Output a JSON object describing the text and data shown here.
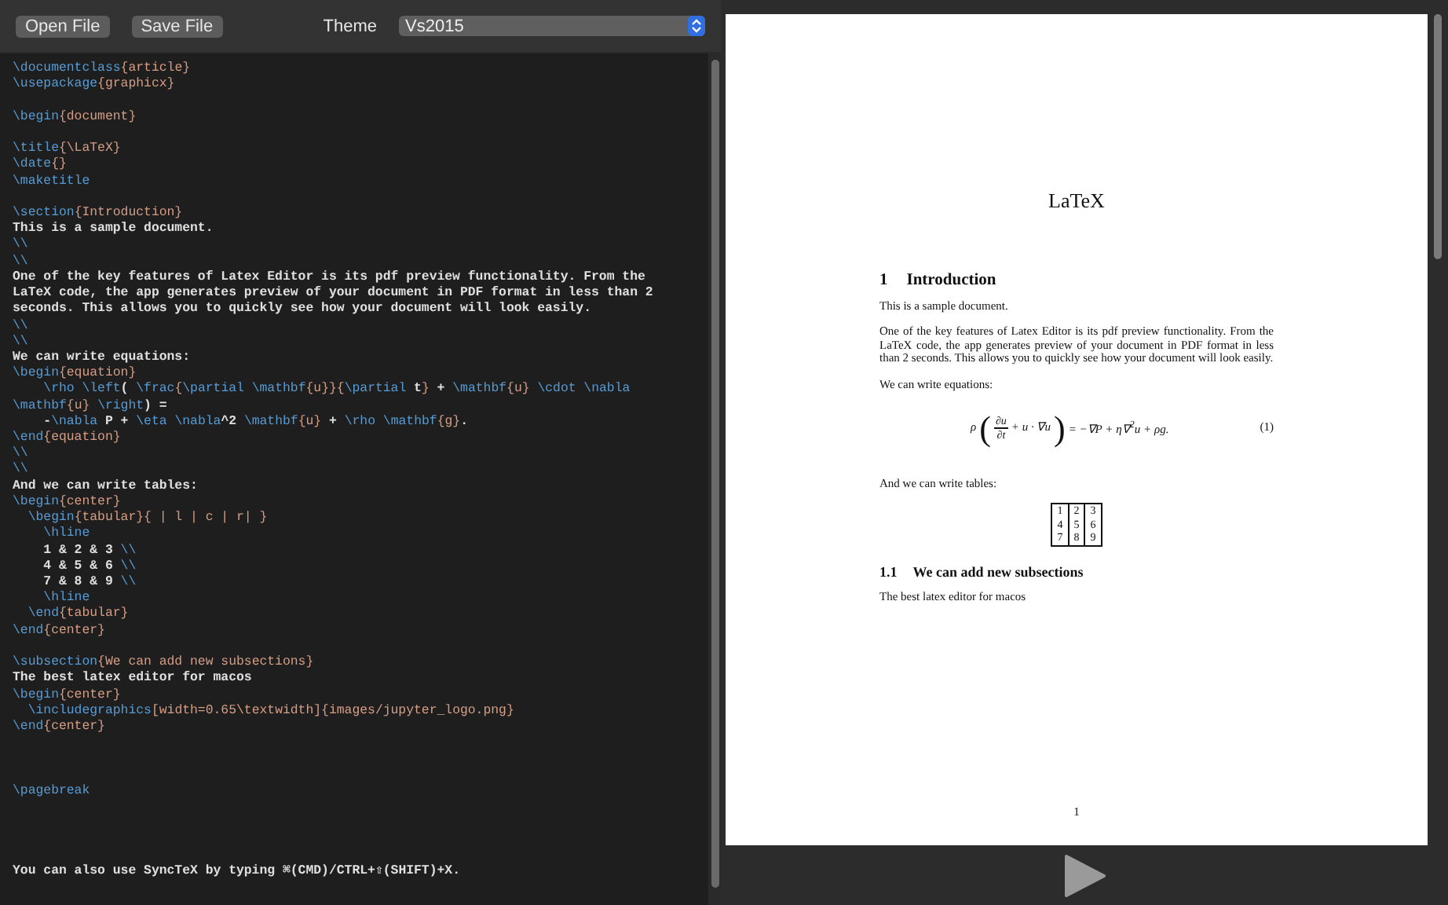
{
  "toolbar": {
    "buttons": [
      {
        "label": "Open File"
      },
      {
        "label": "Save File"
      }
    ],
    "theme_label": "Theme",
    "theme_value": "Vs2015"
  },
  "editor": {
    "lines": [
      {
        "kind": "code",
        "tokens": [
          {
            "kind": "cmd",
            "text": "\\documentclass"
          },
          {
            "kind": "arg",
            "text": "{article}"
          }
        ]
      },
      {
        "kind": "code",
        "tokens": [
          {
            "kind": "cmd",
            "text": "\\usepackage"
          },
          {
            "kind": "arg",
            "text": "{graphicx}"
          }
        ]
      },
      {
        "kind": "blank"
      },
      {
        "kind": "code",
        "tokens": [
          {
            "kind": "cmd",
            "text": "\\begin"
          },
          {
            "kind": "arg",
            "text": "{document}"
          }
        ]
      },
      {
        "kind": "blank"
      },
      {
        "kind": "code",
        "tokens": [
          {
            "kind": "cmd",
            "text": "\\title"
          },
          {
            "kind": "arg",
            "text": "{\\LaTeX}"
          }
        ]
      },
      {
        "kind": "code",
        "tokens": [
          {
            "kind": "cmd",
            "text": "\\date"
          },
          {
            "kind": "arg",
            "text": "{}"
          }
        ]
      },
      {
        "kind": "code",
        "tokens": [
          {
            "kind": "cmd",
            "text": "\\maketitle"
          }
        ]
      },
      {
        "kind": "blank"
      },
      {
        "kind": "code",
        "tokens": [
          {
            "kind": "cmd",
            "text": "\\section"
          },
          {
            "kind": "arg",
            "text": "{Introduction}"
          }
        ]
      },
      {
        "kind": "code",
        "tokens": [
          {
            "kind": "text",
            "text": "This is a sample document."
          }
        ]
      },
      {
        "kind": "code",
        "tokens": [
          {
            "kind": "cmd",
            "text": "\\\\"
          }
        ]
      },
      {
        "kind": "code",
        "tokens": [
          {
            "kind": "cmd",
            "text": "\\\\"
          }
        ]
      },
      {
        "kind": "code",
        "tokens": [
          {
            "kind": "text",
            "text": "One of the key features of Latex Editor is its pdf preview functionality. From the"
          }
        ]
      },
      {
        "kind": "code",
        "tokens": [
          {
            "kind": "text",
            "text": "LaTeX code, the app generates preview of your document in PDF format in less than 2"
          }
        ]
      },
      {
        "kind": "code",
        "tokens": [
          {
            "kind": "text",
            "text": "seconds. This allows you to quickly see how your document will look easily."
          }
        ]
      },
      {
        "kind": "code",
        "tokens": [
          {
            "kind": "cmd",
            "text": "\\\\"
          }
        ]
      },
      {
        "kind": "code",
        "tokens": [
          {
            "kind": "cmd",
            "text": "\\\\"
          }
        ]
      },
      {
        "kind": "code",
        "tokens": [
          {
            "kind": "text",
            "text": "We can write equations:"
          }
        ]
      },
      {
        "kind": "code",
        "tokens": [
          {
            "kind": "cmd",
            "text": "\\begin"
          },
          {
            "kind": "arg",
            "text": "{equation}"
          }
        ]
      },
      {
        "kind": "code",
        "tokens": [
          {
            "kind": "cmd",
            "text": "    \\rho \\left"
          },
          {
            "kind": "text",
            "text": "( "
          },
          {
            "kind": "cmd",
            "text": "\\frac"
          },
          {
            "kind": "arg",
            "text": "{"
          },
          {
            "kind": "cmd",
            "text": "\\partial \\mathbf"
          },
          {
            "kind": "arg",
            "text": "{u}}{"
          },
          {
            "kind": "cmd",
            "text": "\\partial"
          },
          {
            "kind": "text",
            "text": " t"
          },
          {
            "kind": "arg",
            "text": "}"
          },
          {
            "kind": "text",
            "text": " + "
          },
          {
            "kind": "cmd",
            "text": "\\mathbf"
          },
          {
            "kind": "arg",
            "text": "{u} "
          },
          {
            "kind": "cmd",
            "text": "\\cdot \\nabla"
          }
        ]
      },
      {
        "kind": "code",
        "tokens": [
          {
            "kind": "cmd",
            "text": "\\mathbf"
          },
          {
            "kind": "arg",
            "text": "{u} "
          },
          {
            "kind": "cmd",
            "text": "\\right"
          },
          {
            "kind": "text",
            "text": ") ="
          }
        ]
      },
      {
        "kind": "code",
        "tokens": [
          {
            "kind": "text",
            "text": "    -"
          },
          {
            "kind": "cmd",
            "text": "\\nabla"
          },
          {
            "kind": "text",
            "text": " P + "
          },
          {
            "kind": "cmd",
            "text": "\\eta \\nabla"
          },
          {
            "kind": "text",
            "text": "^2 "
          },
          {
            "kind": "cmd",
            "text": "\\mathbf"
          },
          {
            "kind": "arg",
            "text": "{u}"
          },
          {
            "kind": "text",
            "text": " + "
          },
          {
            "kind": "cmd",
            "text": "\\rho \\mathbf"
          },
          {
            "kind": "arg",
            "text": "{g}"
          },
          {
            "kind": "text",
            "text": "."
          }
        ]
      },
      {
        "kind": "code",
        "tokens": [
          {
            "kind": "cmd",
            "text": "\\end"
          },
          {
            "kind": "arg",
            "text": "{equation}"
          }
        ]
      },
      {
        "kind": "code",
        "tokens": [
          {
            "kind": "cmd",
            "text": "\\\\"
          }
        ]
      },
      {
        "kind": "code",
        "tokens": [
          {
            "kind": "cmd",
            "text": "\\\\"
          }
        ]
      },
      {
        "kind": "code",
        "tokens": [
          {
            "kind": "text",
            "text": "And we can write tables:"
          }
        ]
      },
      {
        "kind": "code",
        "tokens": [
          {
            "kind": "cmd",
            "text": "\\begin"
          },
          {
            "kind": "arg",
            "text": "{center}"
          }
        ]
      },
      {
        "kind": "code",
        "tokens": [
          {
            "kind": "cmd",
            "text": "  \\begin"
          },
          {
            "kind": "arg",
            "text": "{tabular}{ | l | c | r| }"
          }
        ]
      },
      {
        "kind": "code",
        "tokens": [
          {
            "kind": "cmd",
            "text": "    \\hline"
          }
        ]
      },
      {
        "kind": "code",
        "tokens": [
          {
            "kind": "text",
            "text": "    1 & 2 & 3 "
          },
          {
            "kind": "cmd",
            "text": "\\\\"
          }
        ]
      },
      {
        "kind": "code",
        "tokens": [
          {
            "kind": "text",
            "text": "    4 & 5 & 6 "
          },
          {
            "kind": "cmd",
            "text": "\\\\"
          }
        ]
      },
      {
        "kind": "code",
        "tokens": [
          {
            "kind": "text",
            "text": "    7 & 8 & 9 "
          },
          {
            "kind": "cmd",
            "text": "\\\\"
          }
        ]
      },
      {
        "kind": "code",
        "tokens": [
          {
            "kind": "cmd",
            "text": "    \\hline"
          }
        ]
      },
      {
        "kind": "code",
        "tokens": [
          {
            "kind": "cmd",
            "text": "  \\end"
          },
          {
            "kind": "arg",
            "text": "{tabular}"
          }
        ]
      },
      {
        "kind": "code",
        "tokens": [
          {
            "kind": "cmd",
            "text": "\\end"
          },
          {
            "kind": "arg",
            "text": "{center}"
          }
        ]
      },
      {
        "kind": "blank"
      },
      {
        "kind": "code",
        "tokens": [
          {
            "kind": "cmd",
            "text": "\\subsection"
          },
          {
            "kind": "arg",
            "text": "{We can add new subsections}"
          }
        ]
      },
      {
        "kind": "code",
        "tokens": [
          {
            "kind": "text",
            "text": "The best latex editor for macos"
          }
        ]
      },
      {
        "kind": "code",
        "tokens": [
          {
            "kind": "cmd",
            "text": "\\begin"
          },
          {
            "kind": "arg",
            "text": "{center}"
          }
        ]
      },
      {
        "kind": "code",
        "tokens": [
          {
            "kind": "cmd",
            "text": "  \\includegraphics"
          },
          {
            "kind": "arg",
            "text": "[width=0.65\\textwidth]{images/jupyter_logo.png}"
          }
        ]
      },
      {
        "kind": "code",
        "tokens": [
          {
            "kind": "cmd",
            "text": "\\end"
          },
          {
            "kind": "arg",
            "text": "{center}"
          }
        ]
      },
      {
        "kind": "blank"
      },
      {
        "kind": "blank"
      },
      {
        "kind": "blank"
      },
      {
        "kind": "code",
        "tokens": [
          {
            "kind": "cmd",
            "text": "\\pagebreak"
          }
        ]
      },
      {
        "kind": "blank"
      },
      {
        "kind": "blank"
      },
      {
        "kind": "blank"
      },
      {
        "kind": "blank"
      },
      {
        "kind": "code",
        "tokens": [
          {
            "kind": "text",
            "text": "You can also use SyncTeX by typing ⌘(CMD)/CTRL+⇧(SHIFT)+X."
          }
        ]
      }
    ]
  },
  "preview": {
    "title": "LaTeX",
    "section": {
      "number": "1",
      "title": "Introduction"
    },
    "paragraphs": [
      "This is a sample document.",
      "One of the key features of Latex Editor is its pdf preview functionality. From the LaTeX code, the app generates preview of your document in PDF format in less than 2 seconds. This allows you to quickly see how your document will look easily.",
      "We can write equations:"
    ],
    "equation": {
      "lhs": "ρ",
      "open": "(",
      "numerator": "∂u",
      "denominator": "∂t",
      "inner": "+ u · ∇u",
      "close": ")",
      "rhs": "= −∇P + η∇$^{2}$u + ρg.",
      "number": "(1)"
    },
    "table_intro": "And we can write tables:",
    "table": [
      [
        "1",
        "2",
        "3"
      ],
      [
        "4",
        "5",
        "6"
      ],
      [
        "7",
        "8",
        "9"
      ]
    ],
    "subsection": {
      "number": "1.1",
      "title": "We can add new subsections"
    },
    "subsection_text": "The best latex editor for macos",
    "page_number": "1"
  }
}
